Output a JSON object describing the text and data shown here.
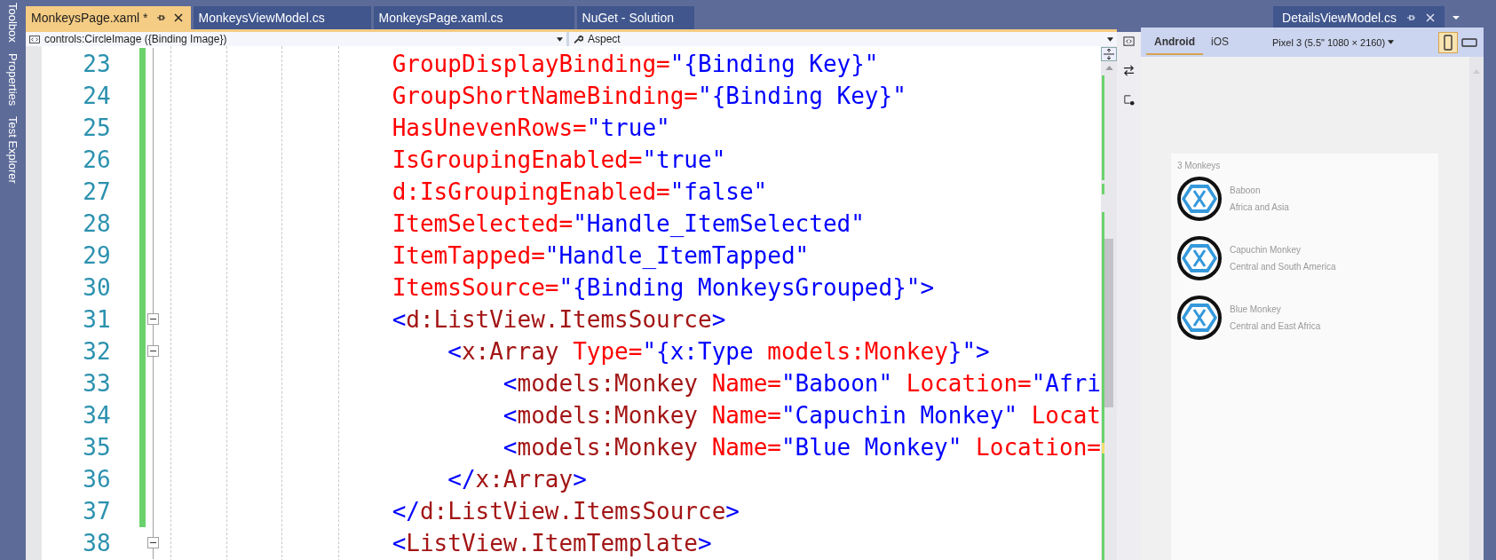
{
  "side_strip": [
    "Toolbox",
    "Properties",
    "Test Explorer"
  ],
  "tabs": [
    {
      "label": "MonkeysPage.xaml *",
      "selected": true
    },
    {
      "label": "MonkeysViewModel.cs",
      "selected": false
    },
    {
      "label": "MonkeysPage.xaml.cs",
      "selected": false
    },
    {
      "label": "NuGet - Solution",
      "selected": false
    }
  ],
  "right_tab": {
    "label": "DetailsViewModel.cs"
  },
  "navigation_bar": {
    "element": "controls:CircleImage ({Binding Image})",
    "member": "Aspect"
  },
  "editor": {
    "lines": [
      {
        "number": "23",
        "changed": true,
        "fold_marker": false,
        "tokens": [
          {
            "kind": "attribute",
            "text": "GroupDisplayBinding="
          },
          {
            "kind": "string",
            "text": "\"{Binding Key}\""
          }
        ]
      },
      {
        "number": "24",
        "changed": true,
        "fold_marker": false,
        "tokens": [
          {
            "kind": "attribute",
            "text": "GroupShortNameBinding="
          },
          {
            "kind": "string",
            "text": "\"{Binding Key}\""
          }
        ]
      },
      {
        "number": "25",
        "changed": true,
        "fold_marker": false,
        "tokens": [
          {
            "kind": "attribute",
            "text": "HasUnevenRows="
          },
          {
            "kind": "string",
            "text": "\"true\""
          }
        ]
      },
      {
        "number": "26",
        "changed": true,
        "fold_marker": false,
        "tokens": [
          {
            "kind": "attribute",
            "text": "IsGroupingEnabled="
          },
          {
            "kind": "string",
            "text": "\"true\""
          }
        ]
      },
      {
        "number": "27",
        "changed": true,
        "fold_marker": false,
        "tokens": [
          {
            "kind": "attribute",
            "text": "d:IsGroupingEnabled="
          },
          {
            "kind": "string",
            "text": "\"false\""
          }
        ]
      },
      {
        "number": "28",
        "changed": true,
        "fold_marker": false,
        "tokens": [
          {
            "kind": "attribute",
            "text": "ItemSelected="
          },
          {
            "kind": "string",
            "text": "\"Handle_ItemSelected\""
          }
        ]
      },
      {
        "number": "29",
        "changed": true,
        "fold_marker": false,
        "tokens": [
          {
            "kind": "attribute",
            "text": "ItemTapped="
          },
          {
            "kind": "string",
            "text": "\"Handle_ItemTapped\""
          }
        ]
      },
      {
        "number": "30",
        "changed": true,
        "fold_marker": false,
        "tokens": [
          {
            "kind": "attribute",
            "text": "ItemsSource="
          },
          {
            "kind": "string",
            "text": "\"{Binding MonkeysGrouped}\">"
          }
        ]
      },
      {
        "number": "31",
        "changed": true,
        "fold_marker": true,
        "tokens": [
          {
            "kind": "delimiter",
            "text": "<"
          },
          {
            "kind": "element",
            "text": "d:ListView.ItemsSource"
          },
          {
            "kind": "delimiter",
            "text": ">"
          }
        ]
      },
      {
        "number": "32",
        "changed": true,
        "fold_marker": true,
        "tokens": [
          {
            "kind": "delimiter",
            "text": "    <"
          },
          {
            "kind": "element",
            "text": "x:Array"
          },
          {
            "kind": "attribute",
            "text": " Type="
          },
          {
            "kind": "string",
            "text": "\"{x:Type "
          },
          {
            "kind": "attribute",
            "text": "models:Monkey"
          },
          {
            "kind": "string",
            "text": "}\">"
          }
        ]
      },
      {
        "number": "33",
        "changed": true,
        "fold_marker": false,
        "tokens": [
          {
            "kind": "delimiter",
            "text": "        <"
          },
          {
            "kind": "element",
            "text": "models:Monkey"
          },
          {
            "kind": "attribute",
            "text": " Name="
          },
          {
            "kind": "string",
            "text": "\"Baboon\""
          },
          {
            "kind": "attribute",
            "text": " Location="
          },
          {
            "kind": "string",
            "text": "\"Afri"
          }
        ]
      },
      {
        "number": "34",
        "changed": true,
        "fold_marker": false,
        "tokens": [
          {
            "kind": "delimiter",
            "text": "        <"
          },
          {
            "kind": "element",
            "text": "models:Monkey"
          },
          {
            "kind": "attribute",
            "text": " Name="
          },
          {
            "kind": "string",
            "text": "\"Capuchin Monkey\""
          },
          {
            "kind": "attribute",
            "text": " Locat"
          }
        ]
      },
      {
        "number": "35",
        "changed": true,
        "fold_marker": false,
        "tokens": [
          {
            "kind": "delimiter",
            "text": "        <"
          },
          {
            "kind": "element",
            "text": "models:Monkey"
          },
          {
            "kind": "attribute",
            "text": " Name="
          },
          {
            "kind": "string",
            "text": "\"Blue Monkey\""
          },
          {
            "kind": "attribute",
            "text": " Location="
          }
        ]
      },
      {
        "number": "36",
        "changed": true,
        "fold_marker": false,
        "tokens": [
          {
            "kind": "delimiter",
            "text": "    </"
          },
          {
            "kind": "element",
            "text": "x:Array"
          },
          {
            "kind": "delimiter",
            "text": ">"
          }
        ]
      },
      {
        "number": "37",
        "changed": true,
        "fold_marker": false,
        "tokens": [
          {
            "kind": "delimiter",
            "text": "</"
          },
          {
            "kind": "element",
            "text": "d:ListView.ItemsSource"
          },
          {
            "kind": "delimiter",
            "text": ">"
          }
        ]
      },
      {
        "number": "38",
        "changed": false,
        "fold_marker": true,
        "tokens": [
          {
            "kind": "delimiter",
            "text": "<"
          },
          {
            "kind": "element",
            "text": "ListView.ItemTemplate"
          },
          {
            "kind": "delimiter",
            "text": ">"
          }
        ]
      }
    ]
  },
  "preview": {
    "platform_tabs": [
      {
        "label": "Android",
        "selected": true
      },
      {
        "label": "iOS",
        "selected": false
      }
    ],
    "device": "Pixel 3 (5.5\" 1080 × 2160)",
    "orientations": [
      {
        "kind": "portrait",
        "selected": true
      },
      {
        "kind": "landscape",
        "selected": false
      }
    ],
    "list": {
      "header": "3 Monkeys",
      "items": [
        {
          "name": "Baboon",
          "location": "Africa and Asia"
        },
        {
          "name": "Capuchin Monkey",
          "location": "Central and South America"
        },
        {
          "name": "Blue Monkey",
          "location": "Central and East Africa"
        }
      ]
    }
  }
}
